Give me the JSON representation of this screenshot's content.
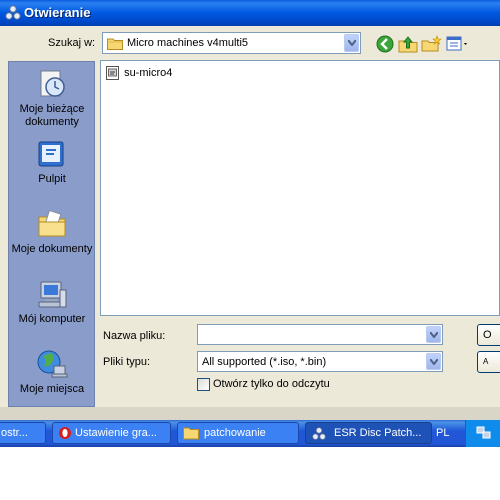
{
  "window": {
    "title": "Otwieranie"
  },
  "lookin": {
    "label": "Szukaj w:",
    "value": "Micro machines v4multi5"
  },
  "toolbar": [
    "back-icon",
    "up-folder-icon",
    "new-folder-icon",
    "view-menu-icon"
  ],
  "places": [
    {
      "name": "place-recent",
      "icon": "recent-documents-icon",
      "label": [
        "Moje bieżące",
        "dokumenty"
      ]
    },
    {
      "name": "place-desktop",
      "icon": "desktop-icon",
      "label": [
        "Pulpit"
      ]
    },
    {
      "name": "place-documents",
      "icon": "my-documents-icon",
      "label": [
        "Moje dokumenty"
      ]
    },
    {
      "name": "place-computer",
      "icon": "my-computer-icon",
      "label": [
        "Mój komputer"
      ]
    },
    {
      "name": "place-network",
      "icon": "network-places-icon",
      "label": [
        "Moje miejsca"
      ]
    }
  ],
  "files": [
    {
      "name": "su-micro4",
      "icon": "file-icon"
    }
  ],
  "filename": {
    "label": "Nazwa pliku:",
    "value": ""
  },
  "filetype": {
    "label": "Pliki typu:",
    "value": "All supported (*.iso, *.bin)"
  },
  "readonly": {
    "label": "Otwórz tylko do odczytu",
    "checked": false
  },
  "buttons": {
    "open": "O",
    "cancel": "A"
  },
  "taskbar": {
    "tasks": [
      {
        "label": "ostr...",
        "active": false
      },
      {
        "label": "Ustawienie gra...",
        "active": false,
        "icon": "opera-icon"
      },
      {
        "label": "patchowanie",
        "active": false,
        "icon": "folder-icon"
      },
      {
        "label": "ESR Disc Patch...",
        "active": true,
        "icon": "app-icon"
      }
    ],
    "language": "PL"
  },
  "colors": {
    "title_bar": "#0058e0",
    "places_bar": "#8a9cc9",
    "dialog_bg": "#ece9d8",
    "taskbar": "#2157d7"
  }
}
